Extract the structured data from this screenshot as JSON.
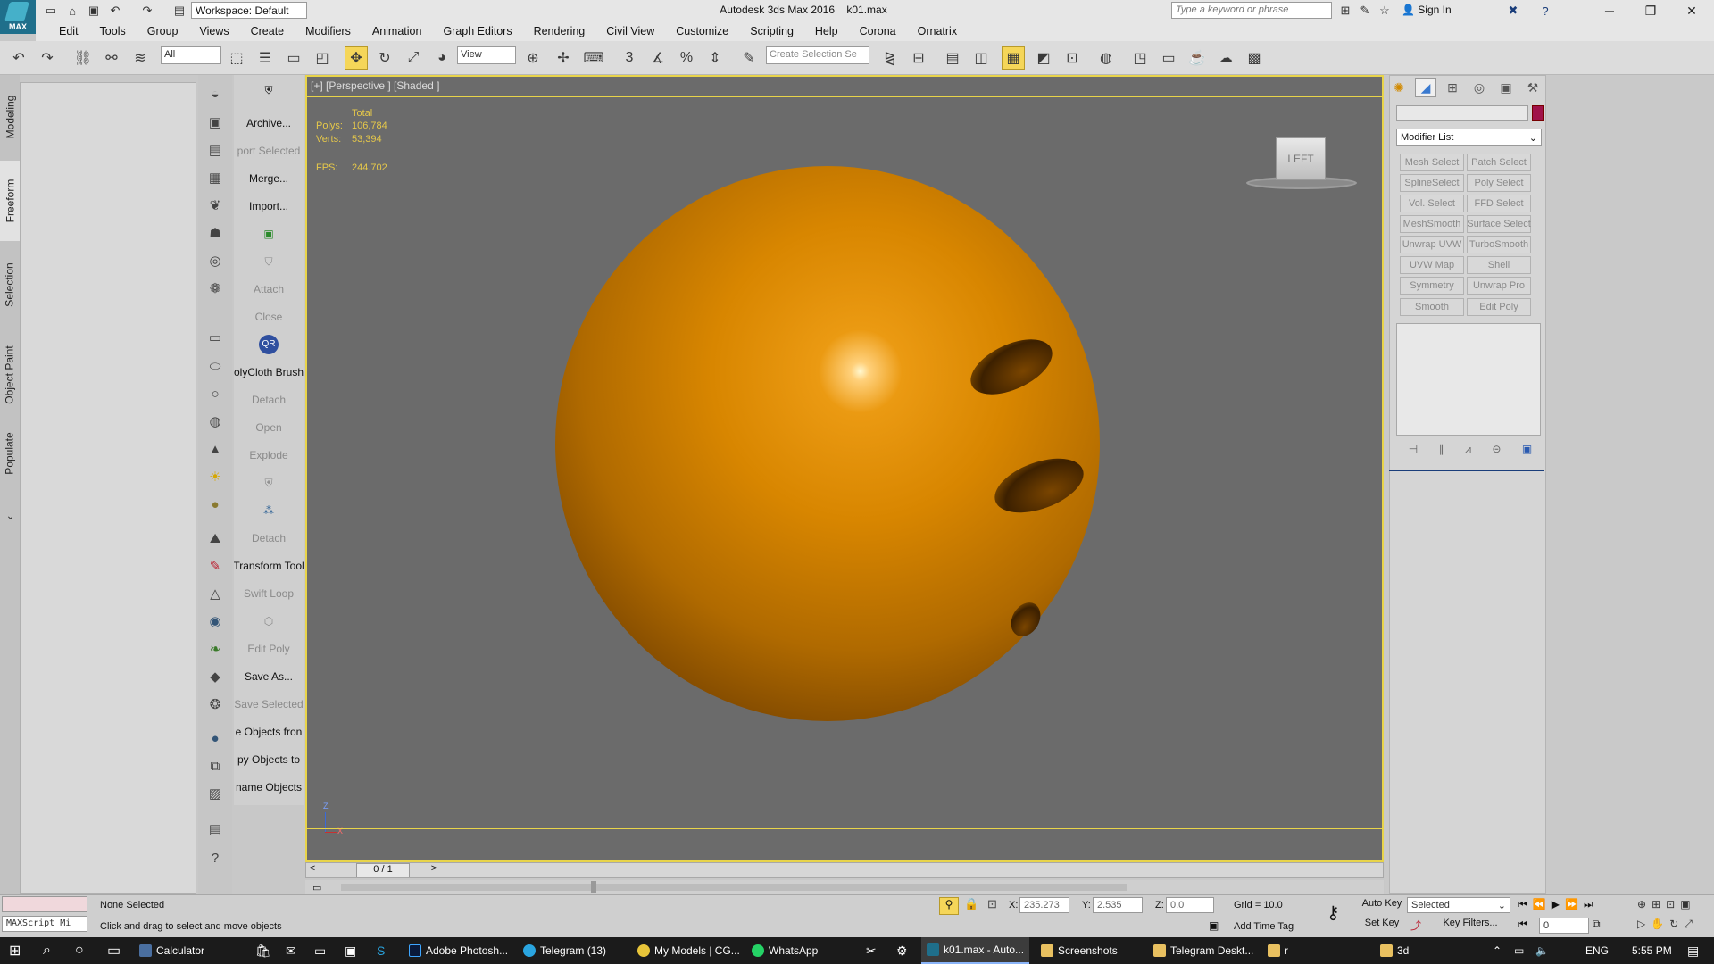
{
  "app": {
    "title": "Autodesk 3ds Max 2016",
    "filename": "k01.max",
    "logo_text": "MAX"
  },
  "titlebar": {
    "workspace": "Workspace: Default",
    "search_placeholder": "Type a keyword or phrase",
    "sign_in": "Sign In"
  },
  "menu": [
    "Edit",
    "Tools",
    "Group",
    "Views",
    "Create",
    "Modifiers",
    "Animation",
    "Graph Editors",
    "Rendering",
    "Civil View",
    "Customize",
    "Scripting",
    "Help",
    "Corona",
    "Ornatrix"
  ],
  "toolbar": {
    "filter": "All",
    "ref_coord": "View",
    "selection_set_placeholder": "Create Selection Se"
  },
  "ribbon_tabs": [
    "Modeling",
    "Freeform",
    "Selection",
    "Object Paint",
    "Populate"
  ],
  "command_panel": [
    {
      "label": "Archive...",
      "enabled": true
    },
    {
      "label": "port Selected",
      "enabled": false
    },
    {
      "label": "Merge...",
      "enabled": true
    },
    {
      "label": "Import...",
      "enabled": true
    },
    {
      "label": "",
      "enabled": true
    },
    {
      "label": "",
      "enabled": false
    },
    {
      "label": "Attach",
      "enabled": false
    },
    {
      "label": "Close",
      "enabled": false
    },
    {
      "label": "",
      "enabled": true
    },
    {
      "label": "olyCloth Brush",
      "enabled": true
    },
    {
      "label": "Detach",
      "enabled": false
    },
    {
      "label": "Open",
      "enabled": false
    },
    {
      "label": "Explode",
      "enabled": false
    },
    {
      "label": "",
      "enabled": false
    },
    {
      "label": "",
      "enabled": true
    },
    {
      "label": "Detach",
      "enabled": false
    },
    {
      "label": "Transform Tool",
      "enabled": true
    },
    {
      "label": "Swift Loop",
      "enabled": false
    },
    {
      "label": "",
      "enabled": false
    },
    {
      "label": "Edit Poly",
      "enabled": false
    },
    {
      "label": "Save As...",
      "enabled": true
    },
    {
      "label": "Save Selected",
      "enabled": false
    },
    {
      "label": "e Objects fron",
      "enabled": true
    },
    {
      "label": "py Objects to",
      "enabled": true
    },
    {
      "label": "name Objects",
      "enabled": true
    }
  ],
  "viewport": {
    "label": "[+] [Perspective ] [Shaded ]",
    "stats": {
      "header": "Total",
      "polys_label": "Polys:",
      "polys": "106,784",
      "verts_label": "Verts:",
      "verts": "53,394",
      "fps_label": "FPS:",
      "fps": "244.702"
    },
    "viewcube": "LEFT",
    "axis_z": "Z",
    "axis_x": "X"
  },
  "timeline": {
    "frame": "0 / 1",
    "prev": "<",
    "next": ">"
  },
  "right_panel": {
    "modifier_list": "Modifier List",
    "buttons": [
      "Mesh Select",
      "Patch Select",
      "SplineSelect",
      "Poly Select",
      "Vol. Select",
      "FFD Select",
      "MeshSmooth",
      "Surface Select",
      "Unwrap UVW",
      "TurboSmooth",
      "UVW Map",
      "Shell",
      "Symmetry",
      "Unwrap Pro",
      "Smooth",
      "Edit Poly"
    ]
  },
  "status": {
    "none_selected": "None Selected",
    "prompt": "Click and drag to select and move objects",
    "maxscript": "MAXScript Mi",
    "x_label": "X:",
    "x": "235.273",
    "y_label": "Y:",
    "y": "2.535",
    "z_label": "Z:",
    "z": "0.0",
    "grid": "Grid = 10.0",
    "add_time_tag": "Add Time Tag",
    "auto_key": "Auto Key",
    "set_key": "Set Key",
    "selected": "Selected",
    "key_filters": "Key Filters...",
    "frame": "0"
  },
  "taskbar": {
    "items": [
      "Calculator",
      "Adobe Photosh...",
      "Telegram (13)",
      "My Models | CG...",
      "WhatsApp",
      "k01.max - Auto...",
      "Screenshots",
      "Telegram Deskt...",
      "r",
      "3d"
    ],
    "lang": "ENG",
    "time": "5:55 PM"
  }
}
